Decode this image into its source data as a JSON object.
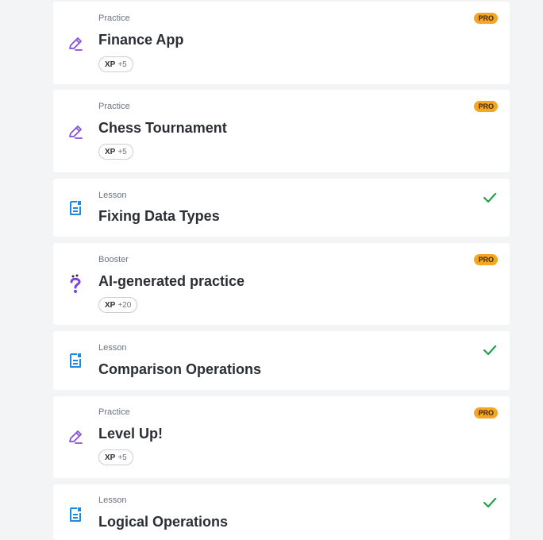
{
  "colors": {
    "background": "#f2f4f6",
    "card": "#ffffff",
    "practice_icon": "#8a4fd8",
    "lesson_icon": "#1e88e5",
    "booster_icon": "#7b3fe4",
    "pro_badge": "#f5a623",
    "check": "#22a04b"
  },
  "items": [
    {
      "type": "Practice",
      "title": "Finance App",
      "icon": "pencil-icon",
      "xp_label": "XP",
      "xp_value": "+5",
      "badge": "PRO"
    },
    {
      "type": "Practice",
      "title": "Chess Tournament",
      "icon": "pencil-icon",
      "xp_label": "XP",
      "xp_value": "+5",
      "badge": "PRO"
    },
    {
      "type": "Lesson",
      "title": "Fixing Data Types",
      "icon": "document-icon",
      "status": "completed-check-icon"
    },
    {
      "type": "Booster",
      "title": "AI-generated practice",
      "icon": "question-mark-icon",
      "xp_label": "XP",
      "xp_value": "+20",
      "badge": "PRO"
    },
    {
      "type": "Lesson",
      "title": "Comparison Operations",
      "icon": "document-icon",
      "status": "completed-check-icon"
    },
    {
      "type": "Practice",
      "title": "Level Up!",
      "icon": "pencil-icon",
      "xp_label": "XP",
      "xp_value": "+5",
      "badge": "PRO"
    },
    {
      "type": "Lesson",
      "title": "Logical Operations",
      "icon": "document-icon",
      "status": "completed-check-icon"
    }
  ]
}
